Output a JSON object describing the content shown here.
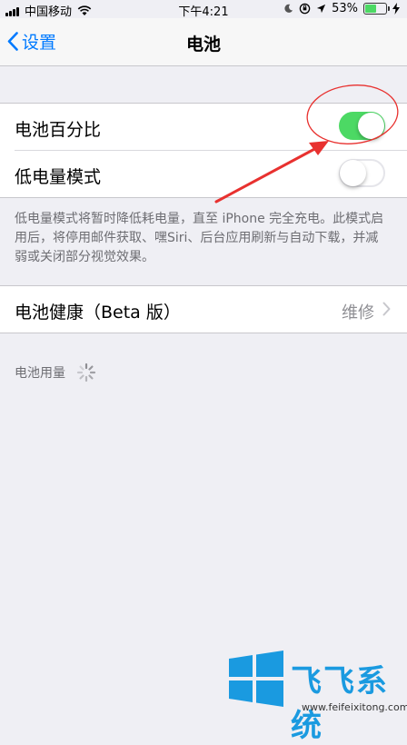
{
  "status_bar": {
    "carrier": "中国移动",
    "time": "下午4:21",
    "battery_percent_text": "53%",
    "battery_level": 0.53
  },
  "nav": {
    "back_label": "设置",
    "title": "电池"
  },
  "settings": {
    "battery_percentage": {
      "label": "电池百分比",
      "enabled": true
    },
    "low_power_mode": {
      "label": "低电量模式",
      "enabled": false
    },
    "low_power_footnote": "低电量模式将暂时降低耗电量，直至 iPhone 完全充电。此模式启用后，将停用邮件获取、嘿Siri、后台应用刷新与自动下载，并减弱或关闭部分视觉效果。",
    "battery_health": {
      "label": "电池健康（Beta 版）",
      "value": "维修"
    },
    "battery_usage_header": "电池用量"
  },
  "watermark": {
    "brand": "飞飞系统",
    "url": "www.feifeixitong.com"
  },
  "colors": {
    "accent": "#007aff",
    "switch_on": "#4cd964",
    "annotation": "#e8312f",
    "background": "#efeff4",
    "watermark": "#1a9ae0"
  }
}
